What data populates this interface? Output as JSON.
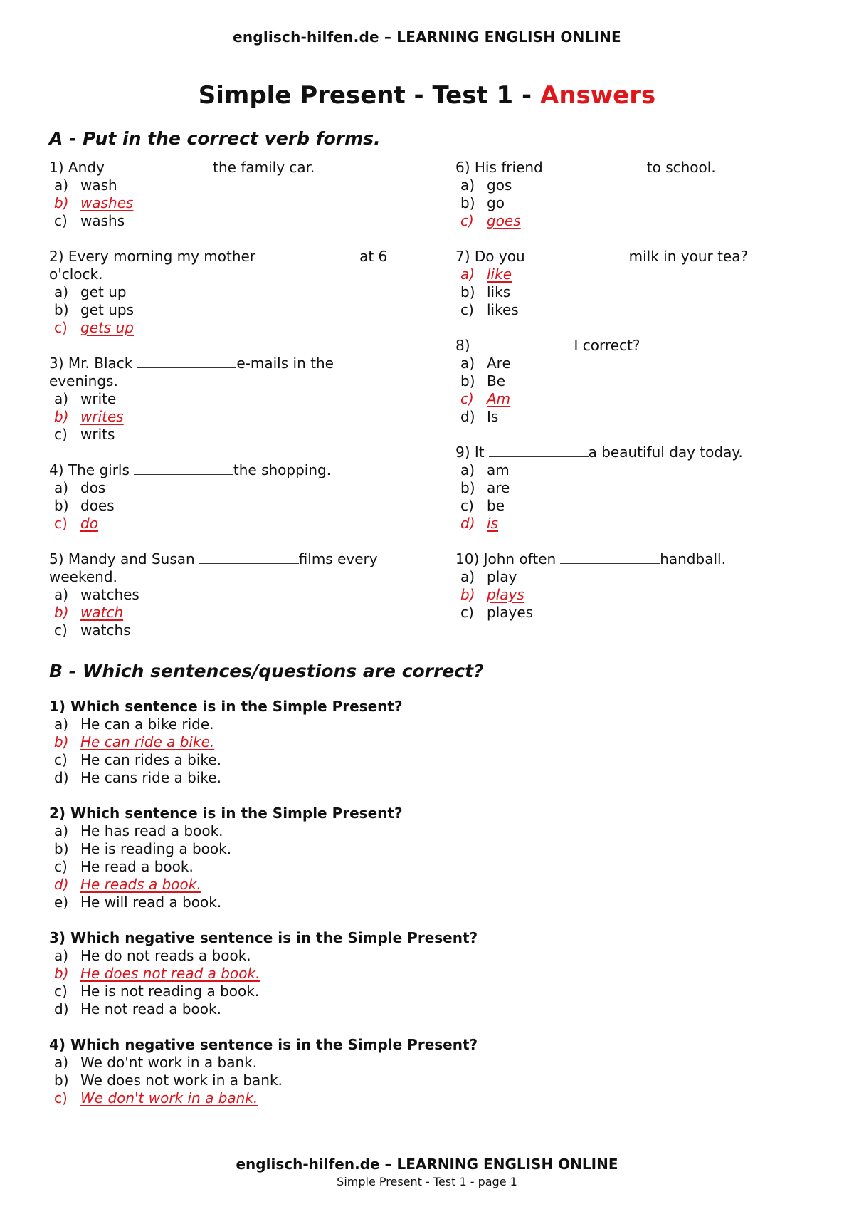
{
  "header": "englisch-hilfen.de – LEARNING ENGLISH ONLINE",
  "title": {
    "main": "Simple Present - Test 1 - ",
    "accent": "Answers"
  },
  "colors": {
    "answer": "#d8141c",
    "title_accent": "#e0161b"
  },
  "sectionA": {
    "heading": "A - Put in the correct verb forms.",
    "left": [
      {
        "before": "1) Andy",
        "after": " the family car.",
        "options": [
          {
            "letter": "a)",
            "text": "wash",
            "correct": false
          },
          {
            "letter": "b)",
            "text": "washes",
            "correct": true
          },
          {
            "letter": "c)",
            "text": "washs",
            "correct": false
          }
        ]
      },
      {
        "before": "2) Every morning my mother",
        "after": "at 6 o'clock.",
        "options": [
          {
            "letter": "a)",
            "text": "get up",
            "correct": false
          },
          {
            "letter": "b)",
            "text": "get ups",
            "correct": false
          },
          {
            "letter": "c)",
            "text": "gets up",
            "correct": true
          }
        ]
      },
      {
        "before": "3) Mr. Black",
        "after": "e-mails in the evenings.",
        "options": [
          {
            "letter": "a)",
            "text": "write",
            "correct": false
          },
          {
            "letter": "b)",
            "text": "writes",
            "correct": true
          },
          {
            "letter": "c)",
            "text": "writs",
            "correct": false
          }
        ]
      },
      {
        "before": "4) The girls",
        "after": "the shopping.",
        "options": [
          {
            "letter": "a)",
            "text": "dos",
            "correct": false
          },
          {
            "letter": "b)",
            "text": "does",
            "correct": false
          },
          {
            "letter": "c)",
            "text": "do",
            "correct": true
          }
        ]
      },
      {
        "before": "5) Mandy and Susan",
        "after": "films every weekend.",
        "options": [
          {
            "letter": "a)",
            "text": "watches",
            "correct": false
          },
          {
            "letter": "b)",
            "text": "watch",
            "correct": true
          },
          {
            "letter": "c)",
            "text": "watchs",
            "correct": false
          }
        ]
      }
    ],
    "right": [
      {
        "before": "6) His friend",
        "after": "to school.",
        "options": [
          {
            "letter": "a)",
            "text": "gos",
            "correct": false
          },
          {
            "letter": "b)",
            "text": "go",
            "correct": false
          },
          {
            "letter": "c)",
            "text": "goes",
            "correct": true
          }
        ]
      },
      {
        "before": "7) Do you",
        "after": "milk in your tea?",
        "options": [
          {
            "letter": "a)",
            "text": "like",
            "correct": true
          },
          {
            "letter": "b)",
            "text": "liks",
            "correct": false
          },
          {
            "letter": "c)",
            "text": "likes",
            "correct": false
          }
        ]
      },
      {
        "before": "8)",
        "after": "I correct?",
        "options": [
          {
            "letter": "a)",
            "text": "Are",
            "correct": false
          },
          {
            "letter": "b)",
            "text": "Be",
            "correct": false
          },
          {
            "letter": "c)",
            "text": "Am",
            "correct": true
          },
          {
            "letter": "d)",
            "text": "Is",
            "correct": false
          }
        ]
      },
      {
        "before": "9) It",
        "after": "a beautiful day today.",
        "options": [
          {
            "letter": "a)",
            "text": "am",
            "correct": false
          },
          {
            "letter": "b)",
            "text": "are",
            "correct": false
          },
          {
            "letter": "c)",
            "text": "be",
            "correct": false
          },
          {
            "letter": "d)",
            "text": "is",
            "correct": true
          }
        ]
      },
      {
        "before": "10) John often",
        "after": "handball.",
        "options": [
          {
            "letter": "a)",
            "text": "play",
            "correct": false
          },
          {
            "letter": "b)",
            "text": "plays",
            "correct": true
          },
          {
            "letter": "c)",
            "text": "playes",
            "correct": false
          }
        ]
      }
    ]
  },
  "sectionB": {
    "heading": "B - Which sentences/questions are correct?",
    "questions": [
      {
        "title": "1) Which sentence is in the Simple Present?",
        "options": [
          {
            "letter": "a)",
            "text": "He can a bike ride.",
            "correct": false
          },
          {
            "letter": "b)",
            "text": "He can ride a bike.",
            "correct": true
          },
          {
            "letter": "c)",
            "text": "He can rides a bike.",
            "correct": false
          },
          {
            "letter": "d)",
            "text": "He cans ride a bike.",
            "correct": false
          }
        ]
      },
      {
        "title": "2) Which sentence is in the Simple Present?",
        "options": [
          {
            "letter": "a)",
            "text": "He has read a book.",
            "correct": false
          },
          {
            "letter": "b)",
            "text": "He is reading a book.",
            "correct": false
          },
          {
            "letter": "c)",
            "text": "He read a book.",
            "correct": false
          },
          {
            "letter": "d)",
            "text": "He reads a book.",
            "correct": true
          },
          {
            "letter": "e)",
            "text": "He will read a book.",
            "correct": false
          }
        ]
      },
      {
        "title": "3) Which negative sentence is in the Simple Present?",
        "options": [
          {
            "letter": "a)",
            "text": "He do not reads a book.",
            "correct": false
          },
          {
            "letter": "b)",
            "text": "He does not read a book.",
            "correct": true
          },
          {
            "letter": "c)",
            "text": "He is not reading a book.",
            "correct": false
          },
          {
            "letter": "d)",
            "text": "He not read a book.",
            "correct": false
          }
        ]
      },
      {
        "title": "4) Which negative sentence is in the Simple Present?",
        "options": [
          {
            "letter": "a)",
            "text": "We do'nt work in a bank.",
            "correct": false
          },
          {
            "letter": "b)",
            "text": "We does not work in a bank.",
            "correct": false
          },
          {
            "letter": "c)",
            "text": "We don't work in a bank.",
            "correct": true
          }
        ]
      }
    ]
  },
  "footer": {
    "line1": "englisch-hilfen.de – LEARNING ENGLISH ONLINE",
    "line2": "Simple Present - Test 1 - page 1"
  }
}
